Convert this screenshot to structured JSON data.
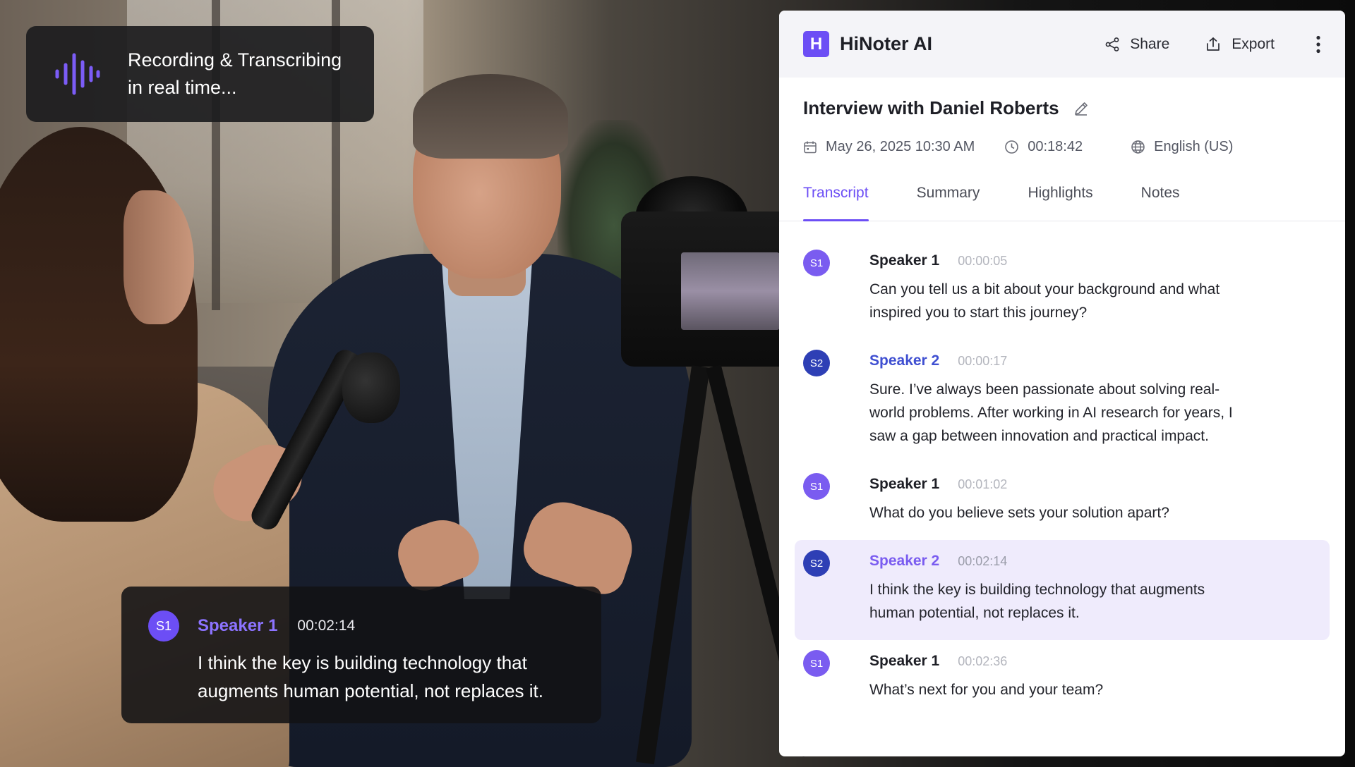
{
  "recording_badge": {
    "line1": "Recording & Transcribing",
    "line2": "in real time...",
    "icon": "audio-wave-icon",
    "accent": "#6c4ef5"
  },
  "live_caption": {
    "avatar": "S1",
    "speaker": "Speaker 1",
    "time": "00:02:14",
    "text": "I think the key is building technology that augments human potential, not replaces it."
  },
  "panel": {
    "logo_letter": "H",
    "app_name": "HiNoter AI",
    "actions": {
      "share": "Share",
      "export": "Export"
    },
    "title": "Interview with Daniel Roberts",
    "date": "May 26, 2025 10:30 AM",
    "duration": "00:18:42",
    "language": "English (US)",
    "tabs": [
      "Transcript",
      "Summary",
      "Highlights",
      "Notes"
    ],
    "active_tab": "Transcript",
    "entries": [
      {
        "avatar": "S1",
        "speaker": "Speaker 1",
        "time": "00:00:05",
        "text": "Can you tell us a bit about your background and what inspired you to start this journey?"
      },
      {
        "avatar": "S2",
        "speaker": "Speaker 2",
        "time": "00:00:17",
        "text": "Sure. I’ve always been passionate about solving real-world problems. After working in AI research for years, I saw a gap between innovation and practical impact."
      },
      {
        "avatar": "S1",
        "speaker": "Speaker 1",
        "time": "00:01:02",
        "text": "What do you believe sets your solution apart?"
      },
      {
        "avatar": "S2",
        "speaker": "Speaker 2",
        "time": "00:02:14",
        "text": "I think the key is building technology that augments human potential, not replaces it."
      },
      {
        "avatar": "S1",
        "speaker": "Speaker 1",
        "time": "00:02:36",
        "text": "What’s next for you and your team?"
      }
    ],
    "colors": {
      "accent": "#6c4ef5",
      "speaker2": "#2e3fb5",
      "highlight_bg": "#efebfc"
    }
  }
}
